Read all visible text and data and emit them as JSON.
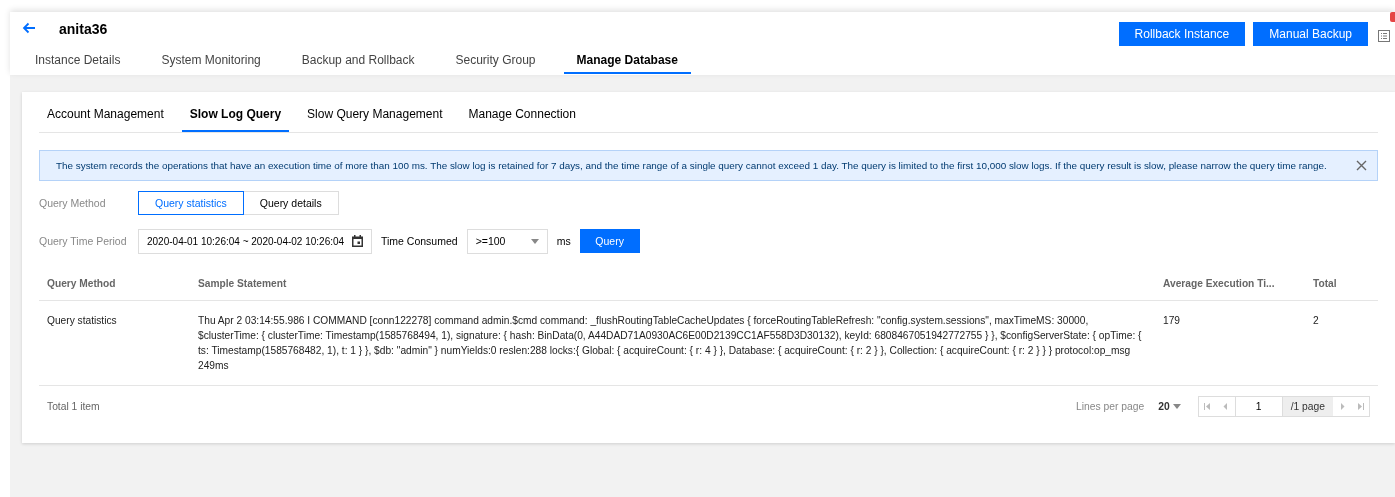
{
  "header": {
    "title": "anita36",
    "buttons": [
      "Rollback Instance",
      "Manual Backup"
    ]
  },
  "tabs": [
    {
      "label": "Instance Details",
      "selected": false
    },
    {
      "label": "System Monitoring",
      "selected": false
    },
    {
      "label": "Backup and Rollback",
      "selected": false
    },
    {
      "label": "Security Group",
      "selected": false
    },
    {
      "label": "Manage Database",
      "selected": true
    }
  ],
  "subtabs": [
    {
      "label": "Account Management",
      "selected": false
    },
    {
      "label": "Slow Log Query",
      "selected": true
    },
    {
      "label": "Slow Query Management",
      "selected": false
    },
    {
      "label": "Manage Connection",
      "selected": false
    }
  ],
  "notice": {
    "text": "The system records the operations that have an execution time of more than 100 ms. The slow log is retained for 7 days, and the time range of a single query cannot exceed 1 day. The query is limited to the first 10,000 slow logs. If the query result is slow, please narrow the query time range."
  },
  "query_method": {
    "label": "Query Method",
    "options": [
      {
        "label": "Query statistics",
        "selected": true
      },
      {
        "label": "Query details",
        "selected": false
      }
    ]
  },
  "time_period": {
    "label": "Query Time Period",
    "value": "2020-04-01 10:26:04 ~ 2020-04-02 10:26:04"
  },
  "time_consumed": {
    "label": "Time Consumed",
    "value": ">=100",
    "unit": "ms"
  },
  "query_button": "Query",
  "table": {
    "columns": [
      "Query Method",
      "Sample Statement",
      "Average Execution Ti...",
      "Total"
    ],
    "rows": [
      [
        "Query statistics",
        "Thu Apr 2 03:14:55.986 I COMMAND [conn122278] command admin.$cmd command: _flushRoutingTableCacheUpdates { forceRoutingTableRefresh: \"config.system.sessions\", maxTimeMS: 30000, $clusterTime: { clusterTime: Timestamp(1585768494, 1), signature: { hash: BinData(0, A44DAD71A0930AC6E00D2139CC1AF558D3D30132), keyId: 6808467051942772755 } }, $configServerState: { opTime: { ts: Timestamp(1585768482, 1), t: 1 } }, $db: \"admin\" } numYields:0 reslen:288 locks:{ Global: { acquireCount: { r: 4 } }, Database: { acquireCount: { r: 2 } }, Collection: { acquireCount: { r: 2 } } } protocol:op_msg 249ms",
        "179",
        "2"
      ]
    ]
  },
  "footer": {
    "total": "Total 1 item",
    "lines_per_page_label": "Lines per page",
    "lines_per_page": "20",
    "page": "1",
    "page_total": "/1 page"
  }
}
